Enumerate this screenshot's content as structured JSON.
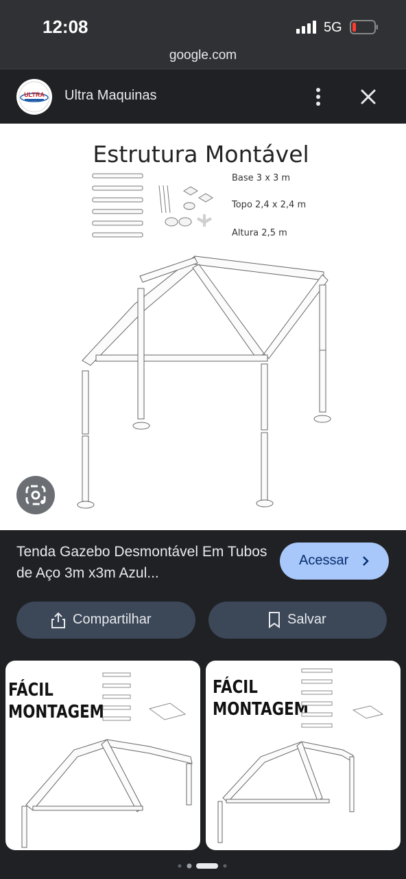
{
  "status_bar": {
    "time": "12:08",
    "network": "5G"
  },
  "browser": {
    "url": "google.com"
  },
  "source": {
    "name": "Ultra Maquinas",
    "logo_text": "ULTRA"
  },
  "image": {
    "title": "Estrutura Montável",
    "specs": [
      "Base 3 x 3 m",
      "Topo 2,4 x 2,4 m",
      "Altura 2,5 m"
    ]
  },
  "result": {
    "caption": "Tenda Gazebo Desmontável Em Tubos de Aço 3m x3m Azul...",
    "visit_label": "Acessar",
    "share_label": "Compartilhar",
    "save_label": "Salvar"
  },
  "related": [
    {
      "title_line1": "FÁCIL",
      "title_line2": "MONTAGEM"
    },
    {
      "title_line1": "FÁCIL",
      "title_line2": "MONTAGEM"
    }
  ],
  "colors": {
    "background": "#202124",
    "accent": "#a8c7fa",
    "pill": "#3c4758"
  },
  "icons": [
    "image-search-lens-icon",
    "share-icon",
    "bookmark-icon",
    "more-vert-icon",
    "close-icon"
  ]
}
